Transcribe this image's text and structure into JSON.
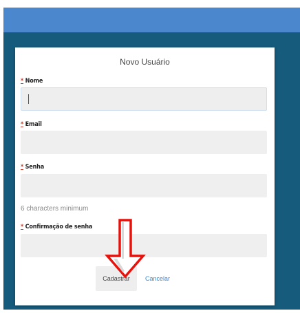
{
  "form": {
    "title": "Novo Usuário",
    "required_marker": "*",
    "fields": [
      {
        "label": "Nome",
        "value": ""
      },
      {
        "label": "Email",
        "value": ""
      },
      {
        "label": "Senha",
        "value": ""
      },
      {
        "label": "Confirmação de senha",
        "value": ""
      }
    ],
    "password_hint": "6 characters minimum",
    "submit_label": "Cadastrar",
    "cancel_label": "Cancelar"
  },
  "annotation": {
    "type": "arrow-down",
    "color": "#e8120c"
  },
  "colors": {
    "top_bar": "#4a87cd",
    "backdrop": "#175b7c",
    "link": "#3d86d0",
    "required": "#c0392b"
  }
}
